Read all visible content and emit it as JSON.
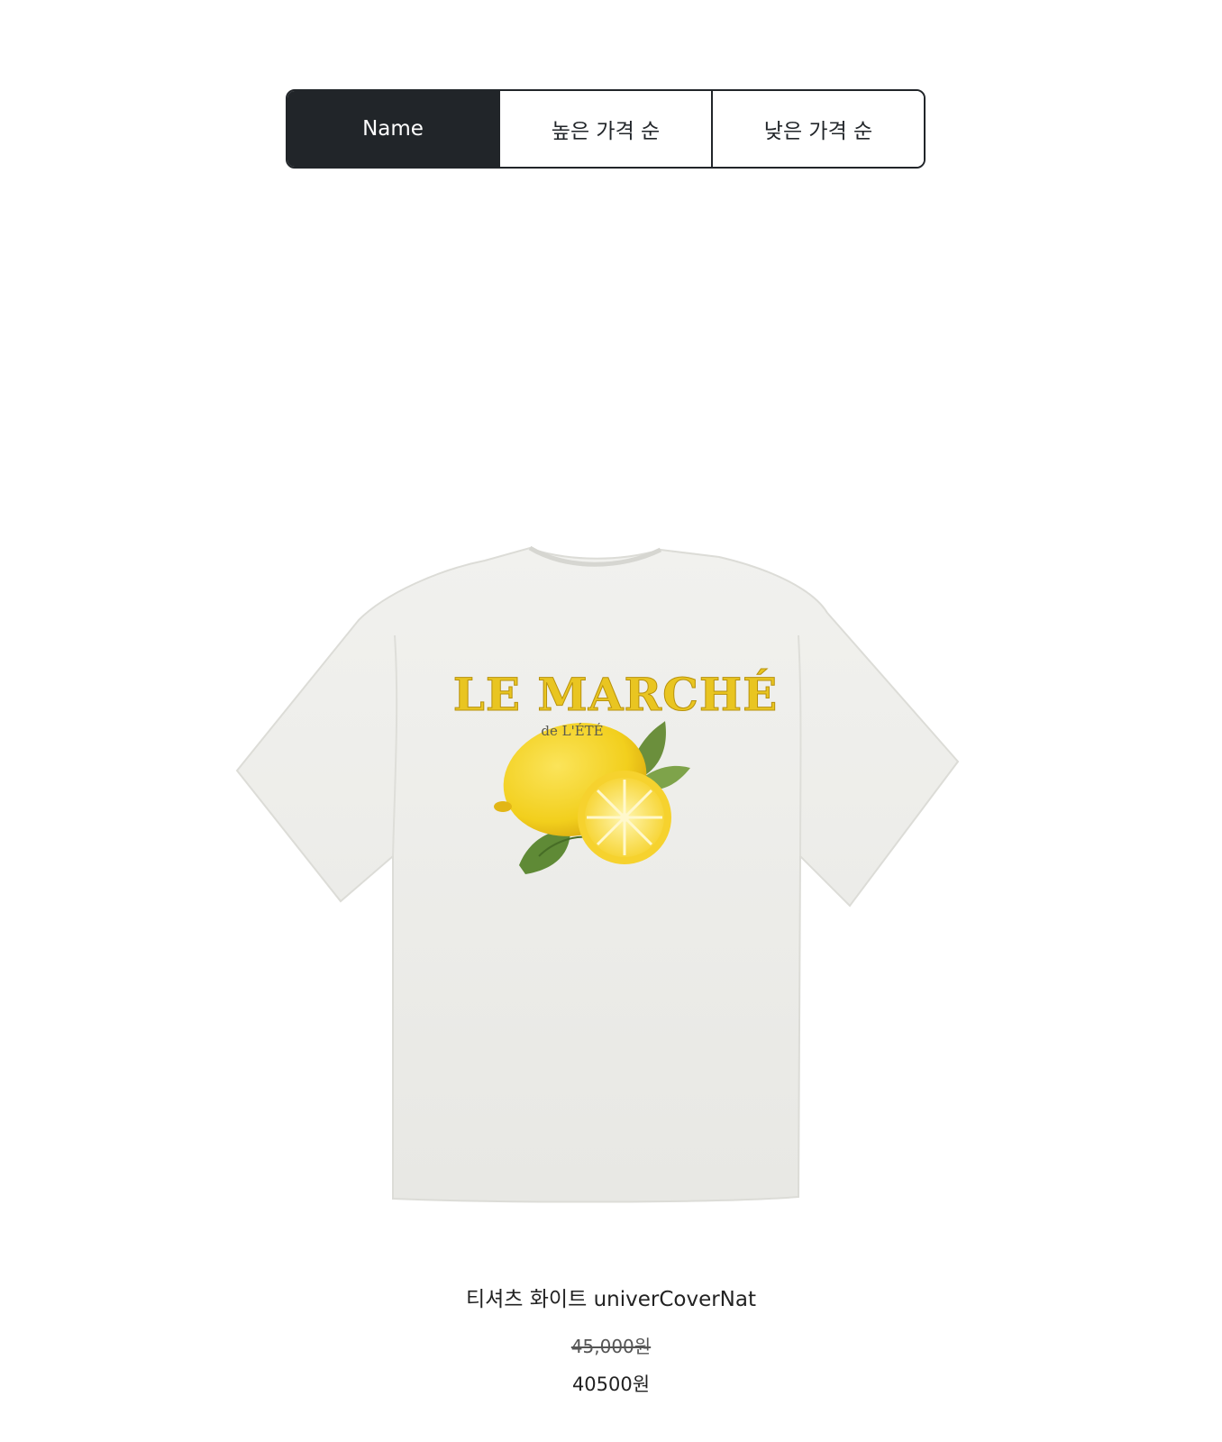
{
  "sort": {
    "options": [
      {
        "label": "Name",
        "active": true
      },
      {
        "label": "높은 가격 순",
        "active": false
      },
      {
        "label": "낮은 가격 순",
        "active": false
      }
    ]
  },
  "product": {
    "name": "티셔츠 화이트 univerCoverNat",
    "original_price": "45,000원",
    "sale_price": "40500원",
    "print_text": {
      "headline": "LE MARCHÉ",
      "subline": "de L'ÉTÉ"
    }
  },
  "colors": {
    "active_bg": "#212529",
    "shirt": "#eeeeeb",
    "lemon": "#f2cf1d",
    "leaf": "#6b8f3c"
  }
}
